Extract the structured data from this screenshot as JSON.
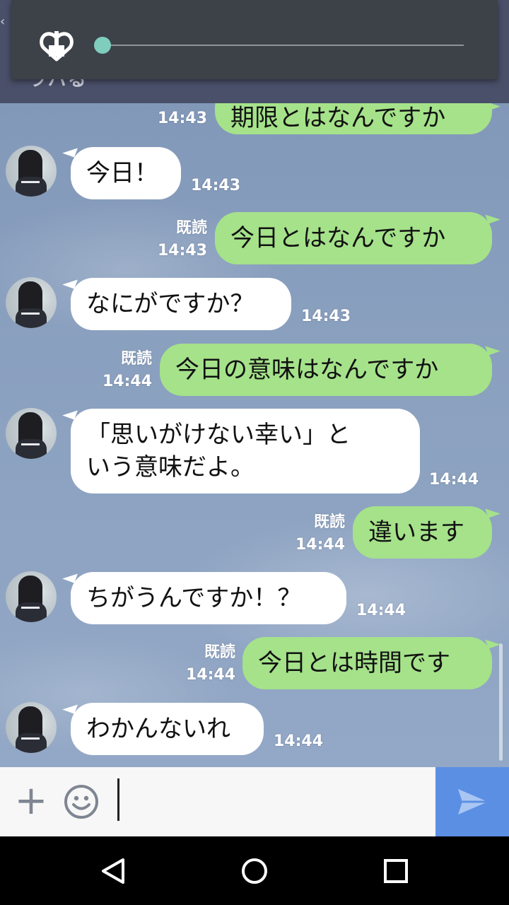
{
  "header": {
    "title_peek": "ラバる",
    "back_peek": "‹"
  },
  "overlay": {
    "volume_level": 0.0
  },
  "messages": [
    {
      "side": "out",
      "text": "期限とはなんですか",
      "time": "14:43",
      "read": ""
    },
    {
      "side": "in",
      "text": "今日！",
      "time": "14:43"
    },
    {
      "side": "out",
      "text": "今日とはなんですか",
      "time": "14:43",
      "read": "既読"
    },
    {
      "side": "in",
      "text": "なにがですか？",
      "time": "14:43"
    },
    {
      "side": "out",
      "text": "今日の意味はなんですか",
      "time": "14:44",
      "read": "既読"
    },
    {
      "side": "in",
      "text": "「思いがけない幸い」と",
      "text2": "いう意味だよ。",
      "time": "14:44"
    },
    {
      "side": "out",
      "text": "違います",
      "time": "14:44",
      "read": "既読"
    },
    {
      "side": "in",
      "text": "ちがうんですか！？",
      "time": "14:44"
    },
    {
      "side": "out",
      "text": "今日とは時間です",
      "time": "14:44",
      "read": "既読"
    },
    {
      "side": "in",
      "text": "わかんないれ",
      "time": "14:44"
    }
  ],
  "input": {
    "value": "",
    "placeholder": ""
  },
  "icons": {
    "plus": "+",
    "emoji": "smiley-icon",
    "send": "send-icon"
  },
  "colors": {
    "header": "#4a5069",
    "bubble_in": "#ffffff",
    "bubble_out": "#a5e28a",
    "send_button": "#5b8fe4",
    "slider_thumb": "#7fcdbd"
  }
}
